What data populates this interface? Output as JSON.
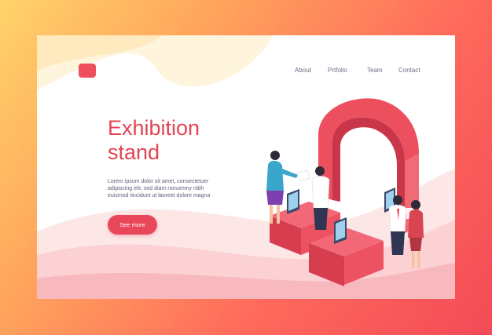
{
  "header": {
    "nav": [
      {
        "label": "About"
      },
      {
        "label": "Prtfolio"
      },
      {
        "label": "Team"
      },
      {
        "label": "Contact"
      }
    ]
  },
  "hero": {
    "title_line1": "Exhibition",
    "title_line2": "stand",
    "description_line1": "Lorem ipsum dolor sit amet, consectetuer",
    "description_line2": "adipiscing elit, sed diam nonummy nibh",
    "description_line3": "euismod tincidunt ut laoreet dolore magna",
    "cta_label": "See more"
  },
  "colors": {
    "accent": "#e8485a",
    "title": "#e24554",
    "nav_text": "#6b6f86",
    "frame_gradient": [
      "#ffd36a",
      "#ff6a5c",
      "#f34a57"
    ]
  }
}
